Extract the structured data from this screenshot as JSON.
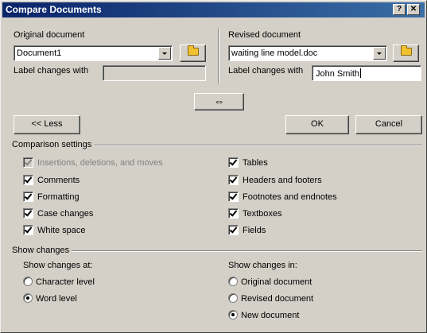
{
  "window": {
    "title": "Compare Documents",
    "help_glyph": "?",
    "close_glyph": "✕"
  },
  "original": {
    "section_label": "Original document",
    "document_value": "Document1",
    "label_changes_label": "Label changes with",
    "label_changes_value": ""
  },
  "revised": {
    "section_label": "Revised document",
    "document_value": "waiting line model.doc",
    "label_changes_label": "Label changes with",
    "label_changes_value": "John Smith"
  },
  "swap_glyph": "⇔",
  "buttons": {
    "less": "<< Less",
    "ok": "OK",
    "cancel": "Cancel"
  },
  "comparison_settings": {
    "heading": "Comparison settings",
    "left": [
      {
        "label": "Insertions, deletions, and moves",
        "checked": true,
        "disabled": true
      },
      {
        "label": "Comments",
        "checked": true
      },
      {
        "label": "Formatting",
        "checked": true
      },
      {
        "label": "Case changes",
        "checked": true
      },
      {
        "label": "White space",
        "checked": true
      }
    ],
    "right": [
      {
        "label": "Tables",
        "checked": true
      },
      {
        "label": "Headers and footers",
        "checked": true
      },
      {
        "label": "Footnotes and endnotes",
        "checked": true
      },
      {
        "label": "Textboxes",
        "checked": true
      },
      {
        "label": "Fields",
        "checked": true
      }
    ]
  },
  "show_changes": {
    "heading": "Show changes",
    "at_label": "Show changes at:",
    "at_options": [
      {
        "label": "Character level",
        "selected": false
      },
      {
        "label": "Word level",
        "selected": true
      }
    ],
    "in_label": "Show changes in:",
    "in_options": [
      {
        "label": "Original document",
        "selected": false
      },
      {
        "label": "Revised document",
        "selected": false
      },
      {
        "label": "New document",
        "selected": true
      }
    ]
  },
  "colors": {
    "face": "#d4d0c8",
    "title_start": "#0a246a",
    "title_end": "#3a6ea5",
    "disabled_text": "#808080"
  }
}
